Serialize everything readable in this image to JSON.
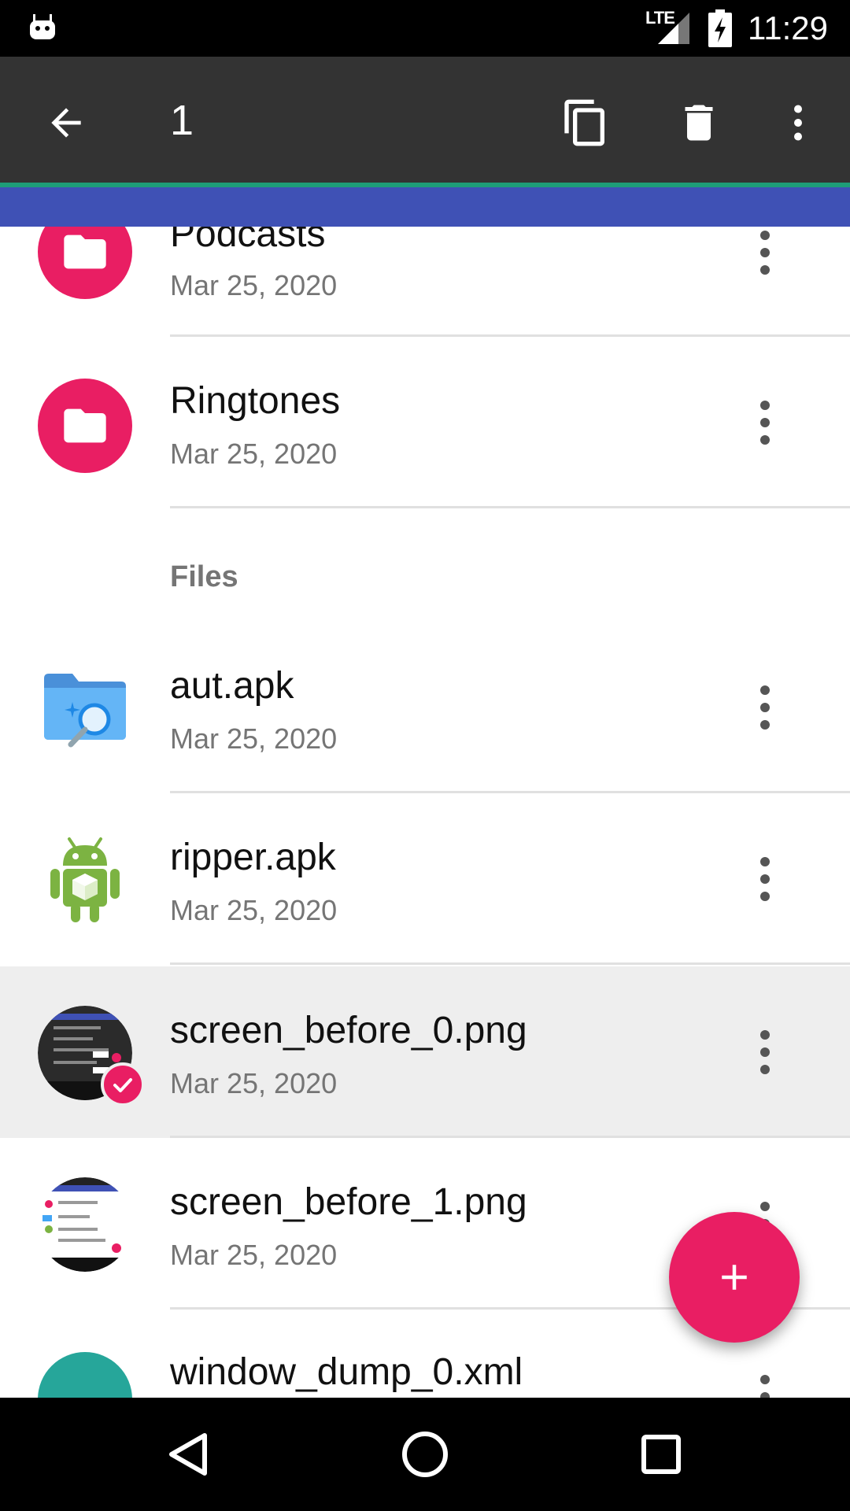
{
  "status_bar": {
    "network": "LTE",
    "time": "11:29"
  },
  "action_bar": {
    "selected_count": "1",
    "icons": [
      "back-arrow-icon",
      "copy-icon",
      "delete-icon",
      "more-vert-icon"
    ],
    "background": "#333333"
  },
  "list": {
    "folders": [
      {
        "name": "Podcasts",
        "date": "Mar 25, 2020",
        "icon": "folder-icon"
      },
      {
        "name": "Ringtones",
        "date": "Mar 25, 2020",
        "icon": "folder-icon"
      }
    ],
    "files_header": "Files",
    "files": [
      {
        "name": "aut.apk",
        "date": "Mar 25, 2020",
        "icon": "apk-search-icon",
        "selected": false
      },
      {
        "name": "ripper.apk",
        "date": "Mar 25, 2020",
        "icon": "android-apk-icon",
        "selected": false
      },
      {
        "name": "screen_before_0.png",
        "date": "Mar 25, 2020",
        "icon": "image-thumbnail",
        "selected": true
      },
      {
        "name": "screen_before_1.png",
        "date": "Mar 25, 2020",
        "icon": "image-thumbnail",
        "selected": false
      },
      {
        "name": "window_dump_0.xml",
        "date": "",
        "icon": "xml-file-icon",
        "selected": false
      }
    ]
  },
  "fab": {
    "icon": "plus-icon",
    "color": "#e91e63"
  },
  "colors": {
    "accent": "#e91e63",
    "primary": "#3f51b5",
    "teal": "#1e9d78",
    "selected_row": "#eeeeee"
  },
  "nav_bar": {
    "icons": [
      "back-triangle-icon",
      "home-circle-icon",
      "recents-square-icon"
    ]
  }
}
